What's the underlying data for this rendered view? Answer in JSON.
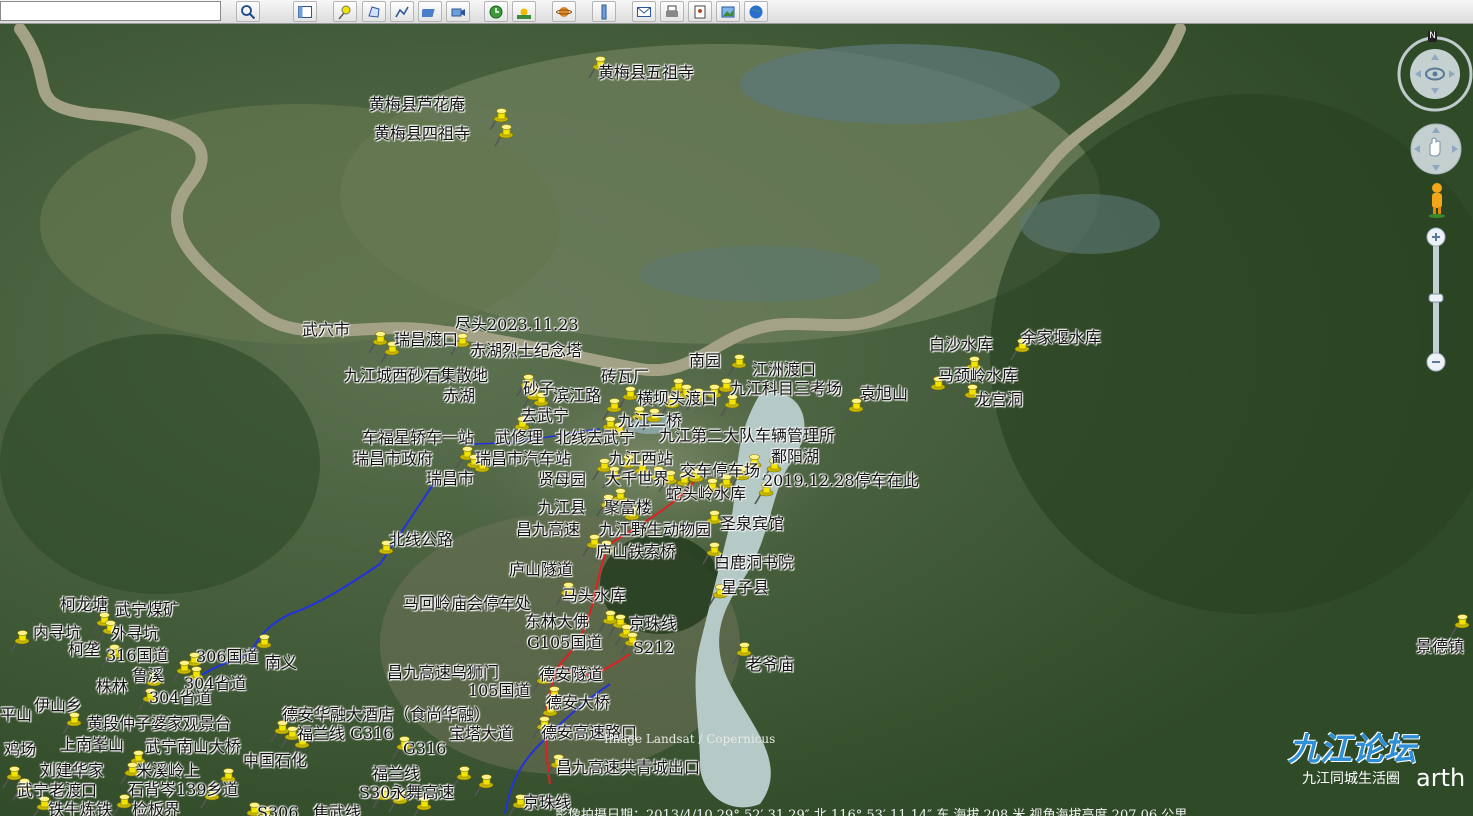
{
  "toolbar": {
    "search_placeholder": "",
    "buttons": [
      {
        "name": "search-button",
        "icon": "magnifier-icon"
      },
      {
        "name": "sidebar-toggle-button",
        "icon": "sidebar-icon"
      },
      {
        "name": "add-placemark-button",
        "icon": "pushpin-icon"
      },
      {
        "name": "add-polygon-button",
        "icon": "polygon-icon"
      },
      {
        "name": "add-path-button",
        "icon": "path-icon"
      },
      {
        "name": "add-overlay-button",
        "icon": "image-overlay-icon"
      },
      {
        "name": "record-tour-button",
        "icon": "tour-icon"
      },
      {
        "name": "historical-imagery-button",
        "icon": "clock-icon"
      },
      {
        "name": "sunlight-button",
        "icon": "sun-icon"
      },
      {
        "name": "planets-button",
        "icon": "planet-icon"
      },
      {
        "name": "ruler-button",
        "icon": "ruler-icon"
      },
      {
        "name": "email-button",
        "icon": "envelope-icon"
      },
      {
        "name": "print-button",
        "icon": "printer-icon"
      },
      {
        "name": "save-image-button",
        "icon": "save-image-icon"
      },
      {
        "name": "view-maps-button",
        "icon": "picture-icon"
      },
      {
        "name": "earth-button",
        "icon": "globe-icon"
      }
    ]
  },
  "labels": [
    {
      "id": "l1",
      "text": "黄梅县五祖寺"
    },
    {
      "id": "l2",
      "text": "黄梅县芦花庵"
    },
    {
      "id": "l3",
      "text": "黄梅县四祖寺"
    },
    {
      "id": "l4",
      "text": "武穴市"
    },
    {
      "id": "l5",
      "text": "瑞昌渡口"
    },
    {
      "id": "l6",
      "text": "尽头2023.11.23"
    },
    {
      "id": "l7",
      "text": "赤湖烈士纪念塔"
    },
    {
      "id": "l8",
      "text": "九江城西砂石集散地"
    },
    {
      "id": "l9",
      "text": "赤湖"
    },
    {
      "id": "l10",
      "text": "砂子"
    },
    {
      "id": "l11",
      "text": "滨江路"
    },
    {
      "id": "l12",
      "text": "砖瓦厂"
    },
    {
      "id": "l13",
      "text": "南园"
    },
    {
      "id": "l14",
      "text": "江洲渡口"
    },
    {
      "id": "l15",
      "text": "九江科目三考场"
    },
    {
      "id": "l16",
      "text": "横坝头渡口"
    },
    {
      "id": "l17",
      "text": "去武宁"
    },
    {
      "id": "l18",
      "text": "九江二桥"
    },
    {
      "id": "l19",
      "text": "白沙水库"
    },
    {
      "id": "l20",
      "text": "余家堰水库"
    },
    {
      "id": "l21",
      "text": "马颈岭水库"
    },
    {
      "id": "l22",
      "text": "袁旭山"
    },
    {
      "id": "l23",
      "text": "龙宫洞"
    },
    {
      "id": "l24",
      "text": "车福星轿车一站"
    },
    {
      "id": "l25",
      "text": "武修理"
    },
    {
      "id": "l26",
      "text": "北线去武宁"
    },
    {
      "id": "l27",
      "text": "九江第二大队车辆管理所"
    },
    {
      "id": "l28",
      "text": "瑞昌市政府"
    },
    {
      "id": "l29",
      "text": "瑞昌市汽车站"
    },
    {
      "id": "l30",
      "text": "九江西站"
    },
    {
      "id": "l31",
      "text": "鄱阳湖"
    },
    {
      "id": "l32",
      "text": "瑞昌市"
    },
    {
      "id": "l33",
      "text": "贤母园"
    },
    {
      "id": "l34",
      "text": "大千世界"
    },
    {
      "id": "l35",
      "text": "交车停车场"
    },
    {
      "id": "l36",
      "text": "2019.12.28停车在此"
    },
    {
      "id": "l37",
      "text": "蛇头岭水库"
    },
    {
      "id": "l38",
      "text": "九江县"
    },
    {
      "id": "l39",
      "text": "聚富楼"
    },
    {
      "id": "l40",
      "text": "昌九高速"
    },
    {
      "id": "l41",
      "text": "九江野生动物园"
    },
    {
      "id": "l42",
      "text": "圣泉宾馆"
    },
    {
      "id": "l43",
      "text": "北线公路"
    },
    {
      "id": "l44",
      "text": "庐山铁索桥"
    },
    {
      "id": "l45",
      "text": "白鹿洞书院"
    },
    {
      "id": "l46",
      "text": "庐山隧道"
    },
    {
      "id": "l47",
      "text": "星子县"
    },
    {
      "id": "l48",
      "text": "马回岭庙会停车处"
    },
    {
      "id": "l49",
      "text": "马头水库"
    },
    {
      "id": "l50",
      "text": "东林大佛"
    },
    {
      "id": "l51",
      "text": "京珠线"
    },
    {
      "id": "l52",
      "text": "G105国道"
    },
    {
      "id": "l53",
      "text": "S212"
    },
    {
      "id": "l54",
      "text": "老爷庙"
    },
    {
      "id": "l55",
      "text": "景德镇"
    },
    {
      "id": "l56",
      "text": "柯龙塘"
    },
    {
      "id": "l57",
      "text": "武宁煤矿"
    },
    {
      "id": "l58",
      "text": "内寻坑"
    },
    {
      "id": "l59",
      "text": "外寻坑"
    },
    {
      "id": "l60",
      "text": "柯垄"
    },
    {
      "id": "l61",
      "text": "316国道"
    },
    {
      "id": "l62",
      "text": "306国道"
    },
    {
      "id": "l63",
      "text": "南义"
    },
    {
      "id": "l64",
      "text": "昌九高速乌狮门"
    },
    {
      "id": "l65",
      "text": "鲁溪"
    },
    {
      "id": "l66",
      "text": "304省道"
    },
    {
      "id": "l67",
      "text": "德安隧道"
    },
    {
      "id": "l68",
      "text": "株林"
    },
    {
      "id": "l69",
      "text": "304省道"
    },
    {
      "id": "l70",
      "text": "105国道"
    },
    {
      "id": "l71",
      "text": "德安大桥"
    },
    {
      "id": "l72",
      "text": "伊山乡"
    },
    {
      "id": "l73",
      "text": "德安华融大酒店（食尚华融）"
    },
    {
      "id": "l74",
      "text": "平山"
    },
    {
      "id": "l75",
      "text": "黄段仲子婆家观景台"
    },
    {
      "id": "l76",
      "text": "福兰线 G316"
    },
    {
      "id": "l77",
      "text": "宝塔大道"
    },
    {
      "id": "l78",
      "text": "德安高速路口"
    },
    {
      "id": "l79",
      "text": "上南峯山"
    },
    {
      "id": "l80",
      "text": "武宁南山大桥"
    },
    {
      "id": "l81",
      "text": "G316"
    },
    {
      "id": "l82",
      "text": "鸡场"
    },
    {
      "id": "l83",
      "text": "中国石化"
    },
    {
      "id": "l84",
      "text": "昌九高速共青城出口"
    },
    {
      "id": "l85",
      "text": "刘建华家"
    },
    {
      "id": "l86",
      "text": "米溪岭上"
    },
    {
      "id": "l87",
      "text": "福兰线"
    },
    {
      "id": "l88",
      "text": "武宁老渡口"
    },
    {
      "id": "l89",
      "text": "石背岑139乡道"
    },
    {
      "id": "l90",
      "text": "S30永舞高速"
    },
    {
      "id": "l91",
      "text": "京珠线"
    },
    {
      "id": "l92",
      "text": "铁牛炼铁"
    },
    {
      "id": "l93",
      "text": "检板界"
    },
    {
      "id": "l94",
      "text": "S306"
    },
    {
      "id": "l95",
      "text": "焦武线"
    }
  ],
  "imagery_credit": "Image Landsat / Copernicus",
  "status": "影像拍摄日期：2013/4/10    29° 52′ 31.29″ 北  116° 53′ 11.14″ 东  海拔   208 米    视角海拔高度  207.06 公里",
  "watermark": {
    "title": "九江论坛",
    "subtitle": "九江同城生活圈",
    "brand": "arth"
  },
  "nav": {
    "north_label": "N"
  },
  "colors": {
    "pin": "#f2e400",
    "route_red": "#e02020",
    "route_blue": "#2233dd",
    "river": "#9a9a7a",
    "water_lake": "#b9cfd0"
  }
}
